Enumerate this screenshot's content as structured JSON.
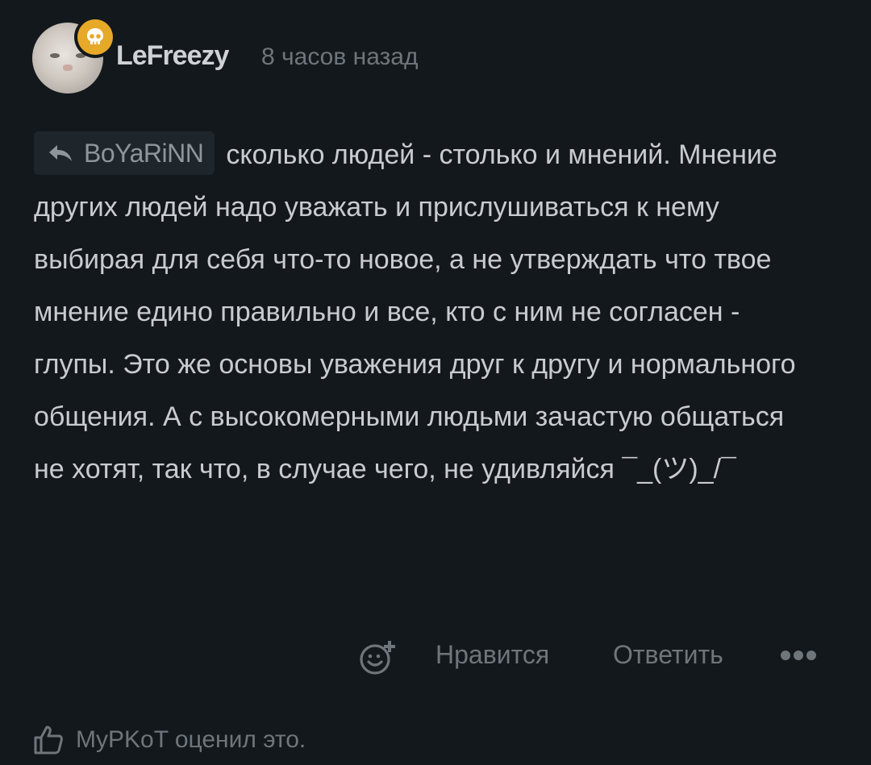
{
  "comment": {
    "author": "LeFreezy",
    "time": "8 часов назад",
    "reply_to": "BoYaRiNN",
    "text": "сколько людей - столько и мнений. Мнение других людей надо уважать и прислушиваться к нему выбирая для себя что-то новое, а не утверждать что твое мнение едино правильно и все, кто с ним не согласен - глупы. Это же основы уважения друг к другу и нормального общения. А с высокомерными людьми зачастую общаться не хотят, так что, в случае чего, не удивляйся ¯_(ツ)_/¯"
  },
  "actions": {
    "like_label": "Нравится",
    "reply_label": "Ответить",
    "reaction_icon": "add-reaction-icon",
    "more_icon": "more-dots-icon"
  },
  "liked_by": {
    "text": "MyPKoT оценил это.",
    "icon": "thumbs-up-icon"
  },
  "colors": {
    "background": "#13181c",
    "text": "#c9cccf",
    "muted": "#6f767b",
    "badge": "#e7a928"
  }
}
